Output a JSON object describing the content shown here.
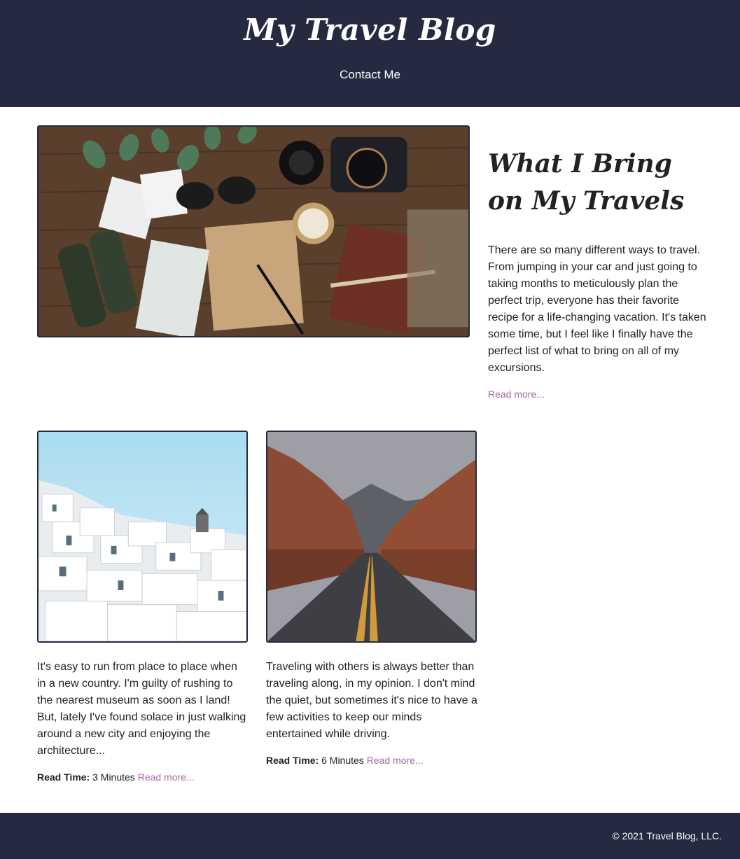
{
  "header": {
    "site_title": "My Travel Blog",
    "nav_link": "Contact Me"
  },
  "featured": {
    "title": "What I Bring on My Travels",
    "excerpt": "There are so many different ways to travel. From jumping in your car and just going to taking months to meticulously plan the perfect trip, everyone has their favorite recipe for a life-changing vacation. It's taken some time, but I feel like I finally have the perfect list of what to bring on all of my excursions.",
    "read_more": "Read more..."
  },
  "posts": [
    {
      "excerpt": "It's easy to run from place to place when in a new country. I'm guilty of rushing to the nearest museum as soon as I land! But, lately I've found solace in just walking around a new city and enjoying the architecture...",
      "read_time_label": "Read Time:",
      "read_time_value": "3 Minutes",
      "read_more": "Read more..."
    },
    {
      "excerpt": "Traveling with others is always better than traveling along, in my opinion. I don't mind the quiet, but sometimes it's nice to have a few activities to keep our minds entertained while driving.",
      "read_time_label": "Read Time:",
      "read_time_value": "6 Minutes",
      "read_more": "Read more..."
    }
  ],
  "footer": {
    "copyright": "© 2021 Travel Blog, LLC."
  },
  "colors": {
    "header_bg": "#252a41",
    "link": "#a6699f",
    "text": "#222222"
  }
}
